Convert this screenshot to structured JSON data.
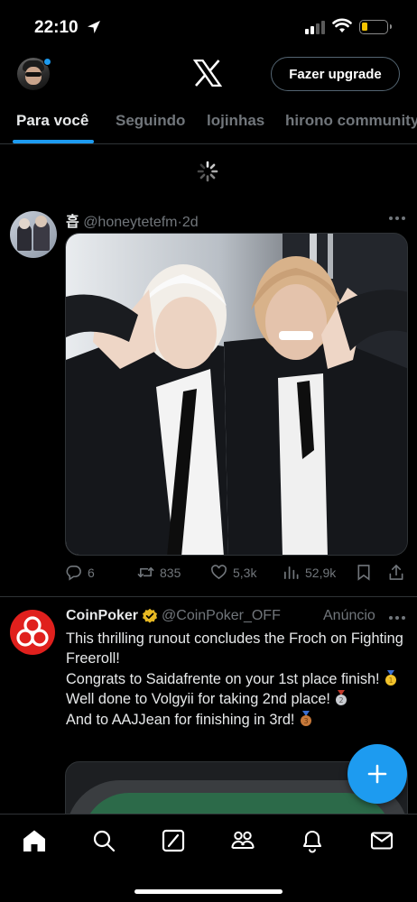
{
  "status_bar": {
    "time": "22:10"
  },
  "header": {
    "upgrade_label": "Fazer upgrade"
  },
  "tabs": [
    {
      "label": "Para você"
    },
    {
      "label": "Seguindo"
    },
    {
      "label": "lojinhas"
    },
    {
      "label": "hirono community"
    }
  ],
  "tweets": [
    {
      "name": "흡",
      "handle": "@honeytetefm",
      "separator": "·",
      "age": "2d",
      "replies": "6",
      "reposts": "835",
      "likes": "5,3k",
      "views": "52,9k"
    },
    {
      "name": "CoinPoker",
      "handle": "@CoinPoker_OFF",
      "ad_label": "Anúncio",
      "lines": [
        "This thrilling runout concludes the Froch on Fighting Freeroll!",
        "Congrats to Saidafrente on your 1st place finish!",
        "Well done to Volgyii for taking 2nd place!",
        "And to AAJJean for finishing in 3rd!"
      ]
    }
  ],
  "colors": {
    "background": "#000000",
    "accent": "#1d9bf0",
    "text_primary": "#e7e9ea",
    "text_secondary": "#71767b",
    "divider": "#2f3336",
    "coinpoker_red": "#e0201d",
    "verified_gold": "#e8b923"
  },
  "icons": {
    "location": "location-arrow-icon",
    "signal": "cellular-signal-icon",
    "wifi": "wifi-icon",
    "battery": "battery-icon",
    "logo": "x-logo-icon",
    "loading": "loading-spinner-icon",
    "more": "more-horizontal-icon",
    "reply": "reply-icon",
    "repost": "repost-icon",
    "like": "heart-icon",
    "views": "views-icon",
    "bookmark": "bookmark-icon",
    "share": "share-icon",
    "verified": "verified-badge-icon",
    "compose": "plus-icon",
    "nav_home": "home-icon",
    "nav_search": "search-icon",
    "nav_grok": "grok-icon",
    "nav_communities": "communities-icon",
    "nav_notifications": "bell-icon",
    "nav_messages": "mail-icon"
  }
}
